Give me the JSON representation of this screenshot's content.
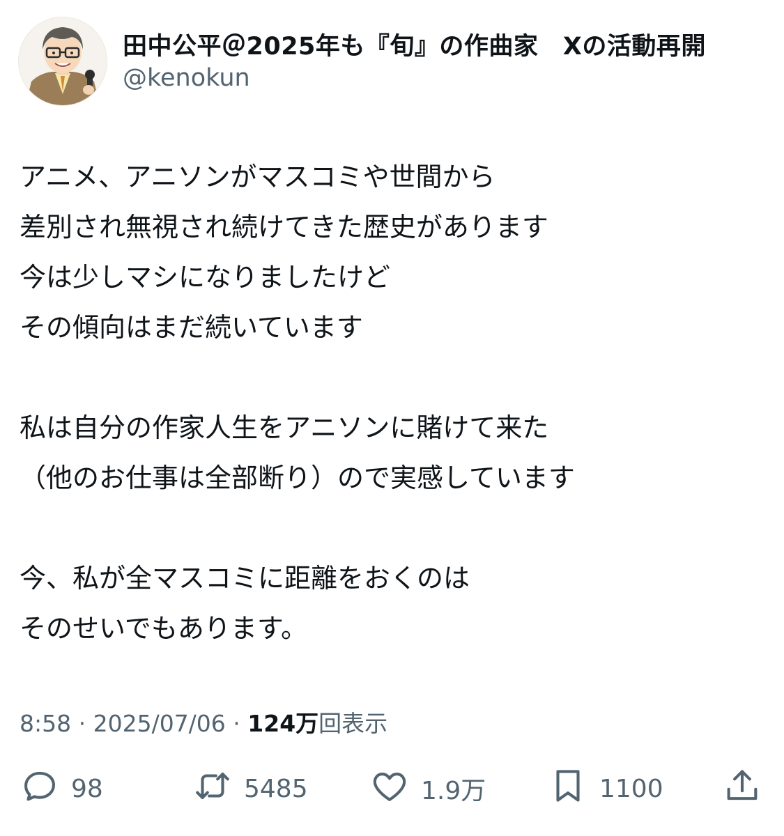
{
  "tweet": {
    "display_name": "田中公平＠2025年も『旬』の作曲家　Xの活動再開",
    "handle": "@kenokun",
    "body": "アニメ、アニソンがマスコミや世間から\n差別され無視され続けてきた歴史があります\n今は少しマシになりましたけど\nその傾向はまだ続いています\n\n私は自分の作家人生をアニソンに賭けて来た\n（他のお仕事は全部断り）ので実感しています\n\n今、私が全マスコミに距離をおくのは\nそのせいでもあります。",
    "time": "8:58",
    "separator": " · ",
    "date": "2025/07/06",
    "views_count": "124万",
    "views_label": "回表示"
  },
  "actions": {
    "reply": {
      "icon": "reply-icon",
      "count": "98"
    },
    "repost": {
      "icon": "repost-icon",
      "count": "5485"
    },
    "like": {
      "icon": "heart-icon",
      "count": "1.9万"
    },
    "bookmark": {
      "icon": "bookmark-icon",
      "count": "1100"
    },
    "share": {
      "icon": "share-icon"
    }
  },
  "colors": {
    "text": "#0f1419",
    "secondary": "#536471",
    "background": "#ffffff"
  }
}
